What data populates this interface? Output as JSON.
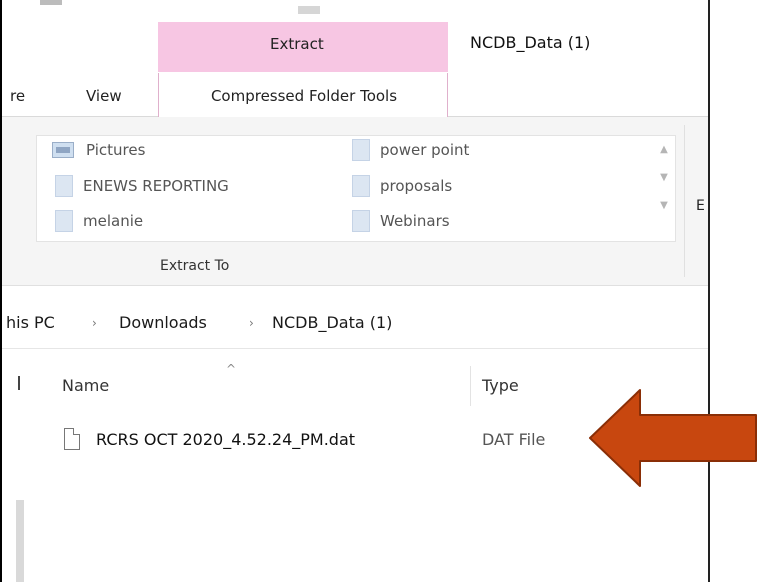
{
  "window": {
    "title": "NCDB_Data (1)"
  },
  "ribbon": {
    "context_tab_label": "Extract",
    "tabs": [
      {
        "label": "re"
      },
      {
        "label": "View"
      },
      {
        "label": "Compressed Folder Tools"
      }
    ],
    "gallery": {
      "col1": [
        "Pictures",
        "ENEWS REPORTING",
        "melanie"
      ],
      "col2": [
        "power point",
        "proposals",
        "Webinars"
      ]
    },
    "group_label": "Extract To",
    "partial_right_label": "E"
  },
  "address": {
    "crumbs": [
      "his PC",
      "Downloads",
      "NCDB_Data (1)"
    ]
  },
  "file_list": {
    "columns": {
      "name": "Name",
      "type": "Type"
    },
    "rows": [
      {
        "name": "RCRS OCT 2020_4.52.24_PM.dat",
        "type": "DAT File"
      }
    ]
  },
  "colors": {
    "context_tab": "#f7c6e3",
    "arrow_fill": "#c8470f",
    "arrow_stroke": "#8a2e06"
  },
  "icons": [
    "pictures-folder-icon",
    "folder-icon",
    "document-icon",
    "sort-caret-icon",
    "arrow-annotation"
  ]
}
